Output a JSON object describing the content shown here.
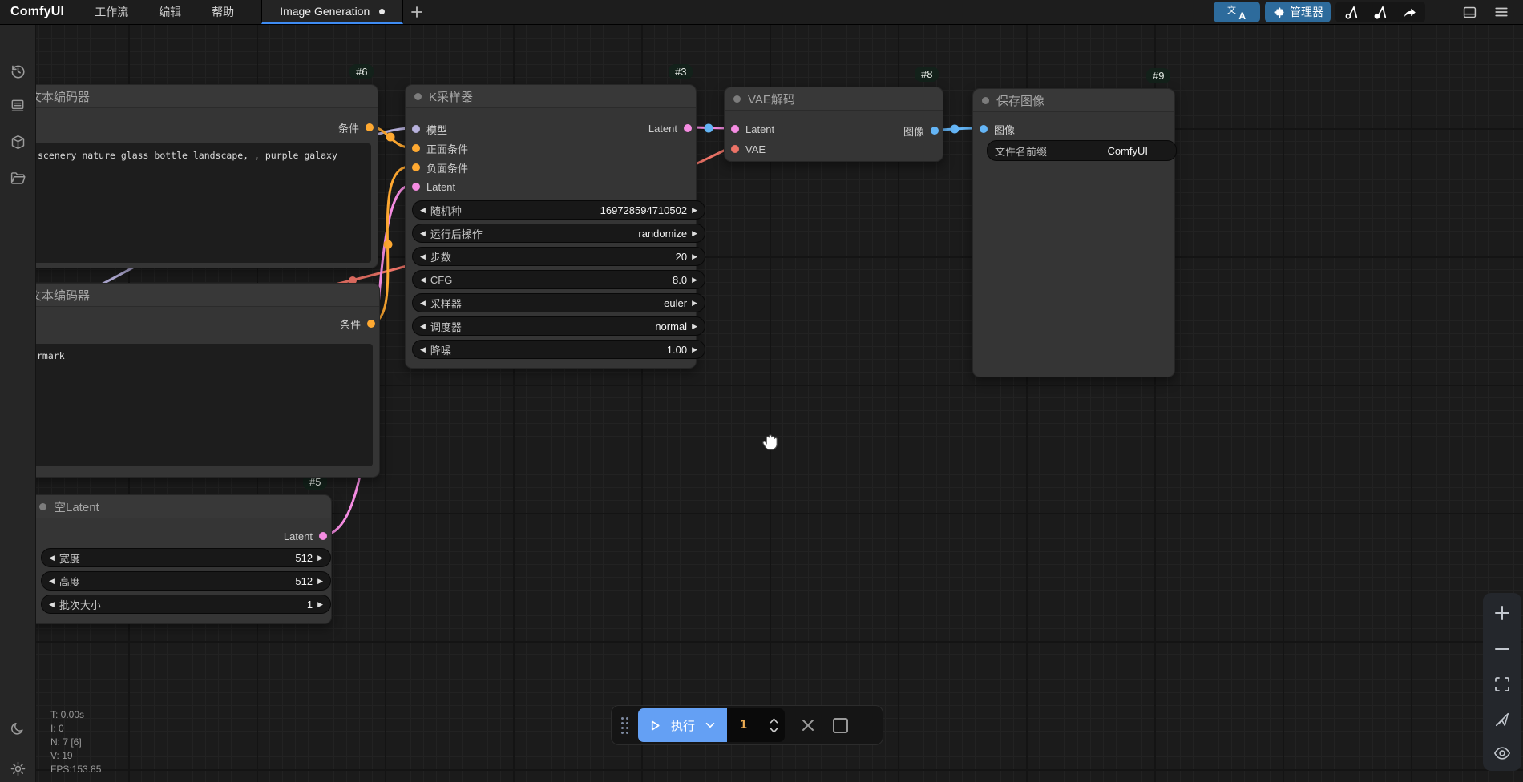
{
  "topbar": {
    "logo": "ComfyUI",
    "menus": [
      {
        "label": "工作流"
      },
      {
        "label": "编辑"
      },
      {
        "label": "帮助"
      }
    ],
    "tab": {
      "label": "Image Generation",
      "dot": "●"
    },
    "translate_icon": {
      "zh": "文",
      "a": "A"
    },
    "manager_button": "管理器"
  },
  "sidebar": {
    "icons": [
      "history",
      "queue",
      "node-library",
      "workflows",
      "theme-toggle",
      "settings"
    ]
  },
  "canvas": {
    "nodes": [
      {
        "badge": "#6",
        "title": "文本编码器",
        "outputs": [
          {
            "name": "条件",
            "type": "CONDITIONING"
          }
        ],
        "text": "scenery nature glass bottle landscape, , purple galaxy"
      },
      {
        "badge": "#3",
        "title": "K采样器",
        "inputs": [
          {
            "name": "模型",
            "type": "MODEL"
          },
          {
            "name": "正面条件",
            "type": "CONDITIONING"
          },
          {
            "name": "负面条件",
            "type": "CONDITIONING"
          },
          {
            "name": "Latent",
            "type": "LATENT"
          }
        ],
        "outputs": [
          {
            "name": "Latent",
            "type": "LATENT"
          }
        ],
        "widgets": [
          {
            "label": "随机种",
            "value": "169728594710502"
          },
          {
            "label": "运行后操作",
            "value": "randomize"
          },
          {
            "label": "步数",
            "value": "20"
          },
          {
            "label": "CFG",
            "value": "8.0"
          },
          {
            "label": "采样器",
            "value": "euler"
          },
          {
            "label": "调度器",
            "value": "normal"
          },
          {
            "label": "降噪",
            "value": "1.00"
          }
        ]
      },
      {
        "badge": "#8",
        "title": "VAE解码",
        "inputs": [
          {
            "name": "Latent",
            "type": "LATENT"
          },
          {
            "name": "VAE",
            "type": "VAE"
          }
        ],
        "outputs": [
          {
            "name": "图像",
            "type": "IMAGE"
          }
        ]
      },
      {
        "badge": "#9",
        "title": "保存图像",
        "inputs": [
          {
            "name": "图像",
            "type": "IMAGE"
          }
        ],
        "widgets": [
          {
            "label": "文件名前缀",
            "value": "ComfyUI"
          }
        ]
      },
      {
        "title": "文本编码器",
        "outputs": [
          {
            "name": "条件",
            "type": "CONDITIONING"
          }
        ],
        "text": "rmark"
      },
      {
        "badge": "#5",
        "title": "空Latent",
        "outputs": [
          {
            "name": "Latent",
            "type": "LATENT"
          }
        ],
        "widgets": [
          {
            "label": "宽度",
            "value": "512"
          },
          {
            "label": "高度",
            "value": "512"
          },
          {
            "label": "批次大小",
            "value": "1"
          }
        ]
      }
    ]
  },
  "runbar": {
    "run_label": "执行",
    "count": "1"
  },
  "stats": {
    "lines": [
      "T: 0.00s",
      "I: 0",
      "N: 7 [6]",
      "V: 19",
      "FPS:153.85"
    ]
  },
  "ui": {
    "arrow_left": "◀",
    "arrow_right": "▶"
  },
  "colors": {
    "accent_blue": "#3f8cf3",
    "toolbar_button_blue": "#2d6b9c",
    "run_button_blue": "#64a0f4",
    "count_orange": "#efae55",
    "badge_bg": "#13211a",
    "slot_model": "#B8B2DD",
    "slot_conditioning": "#FFA931",
    "slot_latent": "#F58CE2",
    "slot_vae": "#ED7367",
    "slot_image": "#64B5F6"
  }
}
